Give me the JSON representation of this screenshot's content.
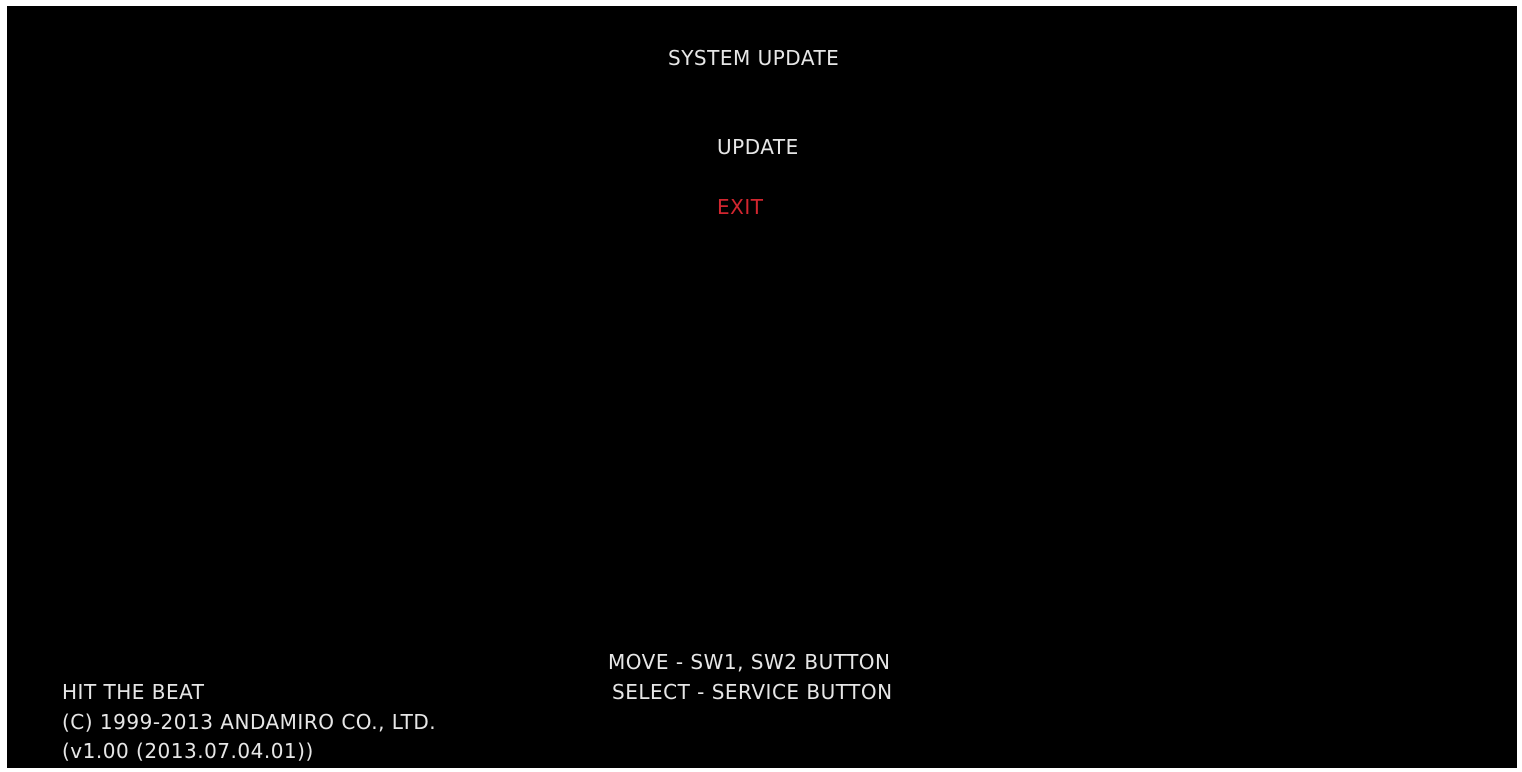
{
  "screen": {
    "title": "SYSTEM UPDATE",
    "menu": {
      "items": [
        {
          "label": "UPDATE",
          "selected": false
        },
        {
          "label": "EXIT",
          "selected": true
        }
      ]
    },
    "help": {
      "move": "MOVE - SW1, SW2 BUTTON",
      "select": "SELECT - SERVICE BUTTON"
    },
    "footer": {
      "game_name": "HIT THE BEAT",
      "copyright": "(C) 1999-2013 ANDAMIRO CO., LTD.",
      "version": "(v1.00 (2013.07.04.01))"
    }
  },
  "colors": {
    "background": "#000000",
    "text": "#e6e6e6",
    "selected": "#d1262f",
    "border": "#ffffff"
  }
}
